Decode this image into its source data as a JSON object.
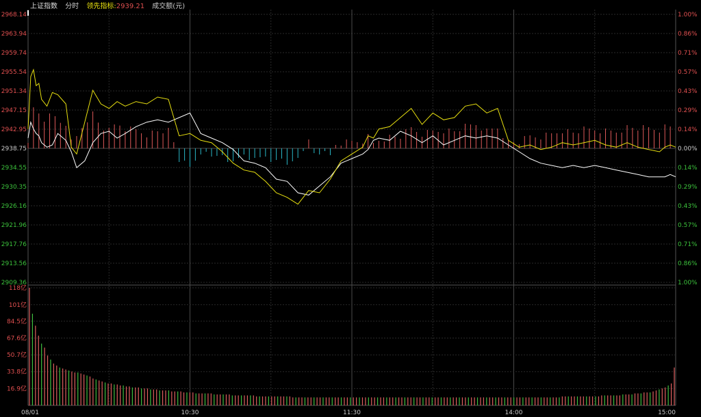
{
  "header": {
    "index_name": "上证指数",
    "period": "分时",
    "leading_label": "领先指标:",
    "leading_value": "2939.21",
    "volume_label": "成交额(元)"
  },
  "colors": {
    "background": "#000000",
    "grid": "#2a2a2a",
    "grid_bright": "#4a4a4a",
    "frame": "#555555",
    "up": "#e05a5a",
    "down": "#2ab8c8",
    "up_text": "#e05050",
    "down_text": "#3cc23c",
    "neutral_text": "#cccccc",
    "price_line": "#ffffff",
    "leading_line": "#e8e010",
    "vol_up": "#e06060",
    "vol_down": "#40c040",
    "header_name": "#dddddd",
    "header_leading": "#e8e010",
    "header_leading_value": "#e05050"
  },
  "chart_data": [
    {
      "type": "line",
      "title": "上证指数 分时",
      "x_ticks": [
        "08/01",
        "10:30",
        "11:30",
        "14:00",
        "15:00"
      ],
      "y_ticks_left": [
        "2968.14",
        "2963.94",
        "2959.74",
        "2955.54",
        "2951.34",
        "2947.15",
        "2942.95",
        "2938.75",
        "2934.55",
        "2930.35",
        "2926.16",
        "2921.96",
        "2917.76",
        "2913.56",
        "2909.36"
      ],
      "y_ticks_right": [
        "1.00%",
        "0.86%",
        "0.71%",
        "0.57%",
        "0.43%",
        "0.29%",
        "0.14%",
        "0.00%",
        "0.14%",
        "0.29%",
        "0.43%",
        "0.57%",
        "0.71%",
        "0.86%",
        "1.00%"
      ],
      "ylim": [
        2909.36,
        2968.14
      ],
      "reference": 2938.75,
      "series": [
        {
          "name": "上证指数",
          "x": [
            0,
            1,
            2,
            3,
            4,
            5,
            7,
            9,
            11,
            14,
            16,
            18,
            21,
            24,
            27,
            30,
            33,
            36,
            40,
            44,
            48,
            52,
            56,
            60,
            64,
            68,
            72,
            76,
            80,
            84,
            88,
            92,
            96,
            100,
            104,
            108,
            112,
            116,
            120,
            124,
            126,
            128,
            130,
            134,
            138,
            142,
            146,
            150,
            154,
            158,
            162,
            166,
            170,
            174,
            178,
            182,
            186,
            190,
            194,
            198,
            202,
            206,
            210,
            214,
            218,
            222,
            226,
            230,
            234,
            236,
            238,
            240
          ],
          "values": [
            2941.0,
            2944.5,
            2943.0,
            2942.0,
            2941.5,
            2940.0,
            2939.0,
            2939.5,
            2942.0,
            2940.5,
            2938.0,
            2934.5,
            2936.0,
            2940.0,
            2942.0,
            2942.5,
            2941.0,
            2942.0,
            2943.5,
            2944.5,
            2945.0,
            2944.5,
            2945.5,
            2946.5,
            2942.0,
            2941.0,
            2940.0,
            2938.5,
            2936.0,
            2935.5,
            2934.5,
            2932.0,
            2931.5,
            2929.0,
            2928.5,
            2930.5,
            2932.5,
            2935.5,
            2936.5,
            2937.5,
            2938.5,
            2940.5,
            2941.0,
            2940.5,
            2942.5,
            2941.5,
            2940.0,
            2941.5,
            2939.5,
            2940.5,
            2941.5,
            2941.0,
            2941.5,
            2941.0,
            2939.5,
            2938.0,
            2936.5,
            2935.5,
            2935.0,
            2934.5,
            2935.0,
            2934.5,
            2935.0,
            2934.5,
            2934.0,
            2933.5,
            2933.0,
            2932.5,
            2932.5,
            2932.5,
            2933.0,
            2932.5
          ]
        },
        {
          "name": "领先指标",
          "x": [
            0,
            1,
            2,
            3,
            4,
            5,
            7,
            9,
            11,
            14,
            16,
            18,
            21,
            24,
            27,
            30,
            33,
            36,
            40,
            44,
            48,
            52,
            56,
            60,
            64,
            68,
            72,
            76,
            80,
            84,
            88,
            92,
            96,
            100,
            104,
            108,
            112,
            116,
            120,
            124,
            126,
            128,
            130,
            134,
            138,
            142,
            146,
            150,
            154,
            158,
            162,
            166,
            170,
            174,
            178,
            182,
            186,
            190,
            194,
            198,
            202,
            206,
            210,
            214,
            218,
            222,
            226,
            230,
            234,
            236,
            238,
            240
          ],
          "values": [
            2943.0,
            2954.5,
            2956.0,
            2952.5,
            2953.0,
            2949.5,
            2948.0,
            2951.0,
            2950.5,
            2948.5,
            2939.0,
            2937.5,
            2944.5,
            2951.5,
            2948.5,
            2947.5,
            2949.0,
            2948.0,
            2949.0,
            2948.5,
            2950.0,
            2949.5,
            2941.5,
            2942.0,
            2940.5,
            2940.0,
            2938.0,
            2935.5,
            2934.0,
            2933.5,
            2931.5,
            2929.0,
            2928.0,
            2926.5,
            2929.5,
            2929.0,
            2932.0,
            2936.0,
            2937.5,
            2939.0,
            2941.5,
            2941.0,
            2943.0,
            2943.5,
            2945.5,
            2947.5,
            2944.0,
            2946.5,
            2945.0,
            2945.5,
            2948.0,
            2948.5,
            2946.5,
            2947.5,
            2940.5,
            2939.0,
            2939.5,
            2938.5,
            2939.0,
            2940.0,
            2939.5,
            2940.0,
            2940.5,
            2939.5,
            2939.0,
            2940.0,
            2939.0,
            2938.5,
            2938.0,
            2939.0,
            2939.5,
            2939.0
          ]
        }
      ]
    },
    {
      "type": "bar",
      "title": "成交额(元)",
      "y_ticks": [
        "118亿",
        "101亿",
        "84.5亿",
        "67.6亿",
        "50.7亿",
        "33.8亿",
        "16.9亿"
      ],
      "ylim": [
        0,
        118
      ],
      "unit": "亿",
      "values": [
        118,
        92,
        80,
        70,
        62,
        58,
        50,
        46,
        42,
        40,
        38,
        37,
        36,
        35,
        34,
        33,
        33,
        32,
        31,
        30,
        29,
        27,
        26,
        25,
        24,
        23,
        22,
        22,
        21,
        21,
        20,
        20,
        19,
        19,
        18,
        18,
        18,
        17,
        17,
        17,
        16,
        16,
        16,
        15,
        15,
        15,
        15,
        14,
        14,
        14,
        14,
        13,
        13,
        13,
        13,
        12,
        12,
        12,
        12,
        12,
        12,
        11,
        11,
        11,
        11,
        11,
        11,
        10,
        10,
        10,
        10,
        10,
        10,
        10,
        10,
        9,
        9,
        9,
        9,
        9,
        9,
        9,
        9,
        9,
        9,
        9,
        9,
        8,
        8,
        8,
        8,
        8,
        8,
        8,
        8,
        8,
        8,
        8,
        8,
        8,
        8,
        8,
        8,
        8,
        8,
        8,
        8,
        8,
        8,
        8,
        8,
        8,
        8,
        8,
        8,
        8,
        8,
        8,
        8,
        8,
        8,
        8,
        8,
        8,
        8,
        8,
        8,
        8,
        8,
        8,
        8,
        8,
        8,
        8,
        8,
        8,
        8,
        8,
        8,
        8,
        8,
        8,
        8,
        8,
        8,
        8,
        8,
        8,
        8,
        8,
        8,
        8,
        8,
        8,
        8,
        8,
        8,
        8,
        8,
        8,
        8,
        8,
        8,
        8,
        8,
        8,
        8,
        8,
        8,
        8,
        8,
        8,
        8,
        8,
        8,
        8,
        9,
        9,
        9,
        9,
        9,
        9,
        9,
        9,
        9,
        9,
        9,
        9,
        9,
        10,
        10,
        10,
        10,
        10,
        10,
        10,
        11,
        11,
        11,
        11,
        12,
        12,
        12,
        13,
        13,
        13,
        14,
        15,
        16,
        17,
        18,
        20,
        22,
        38
      ]
    }
  ]
}
